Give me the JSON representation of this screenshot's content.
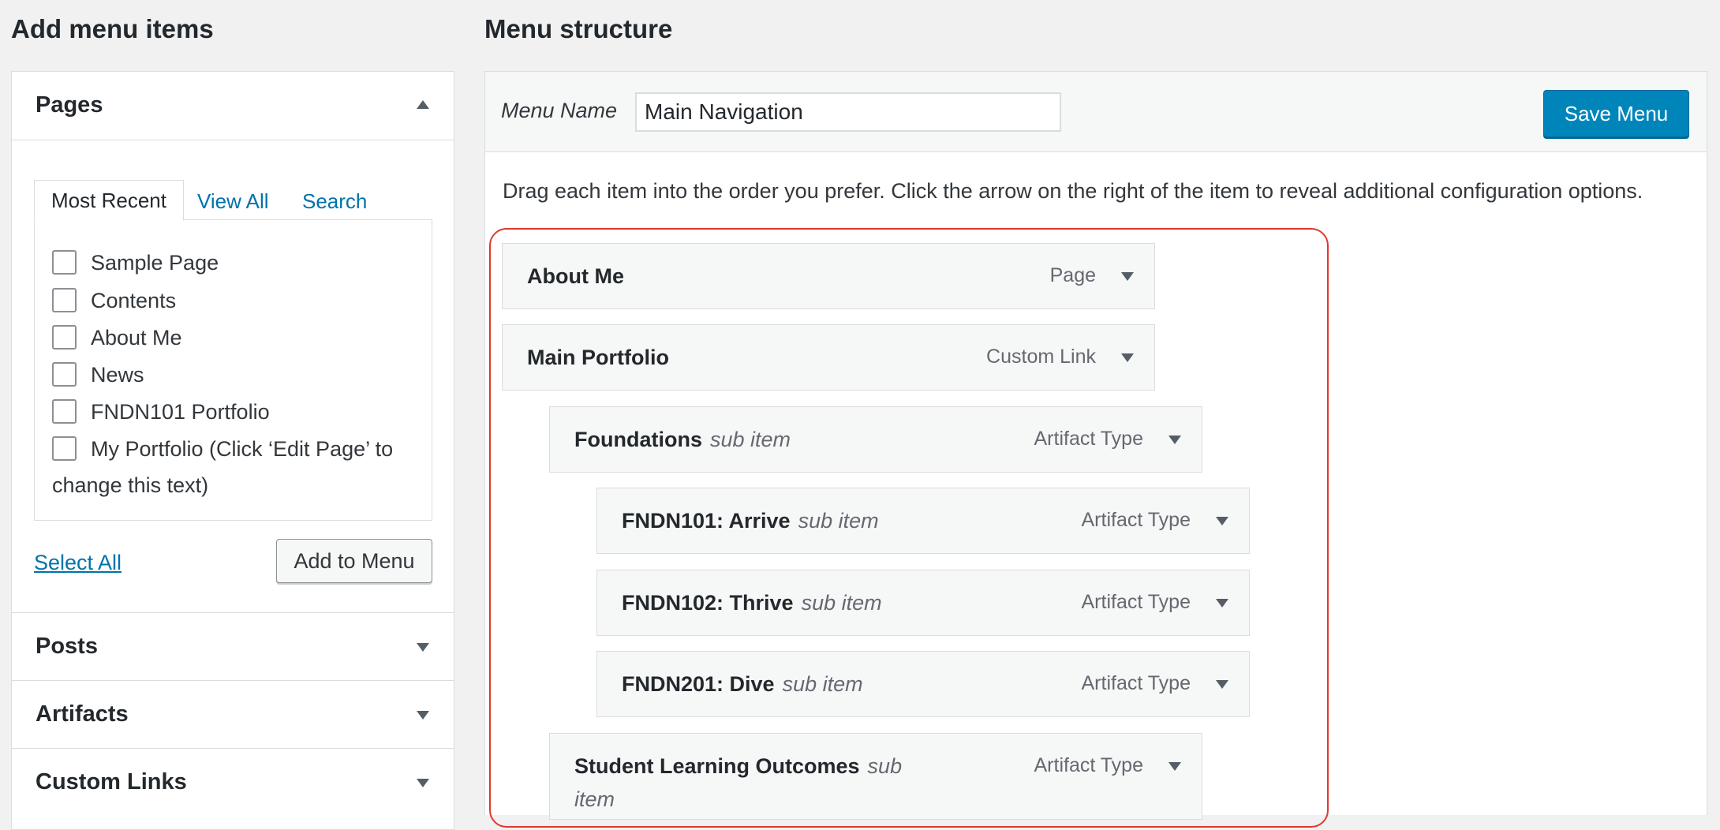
{
  "left": {
    "heading": "Add menu items",
    "pages": {
      "title": "Pages",
      "tabs": [
        "Most Recent",
        "View All",
        "Search"
      ],
      "items": [
        "Sample Page",
        "Contents",
        "About Me",
        "News",
        "FNDN101 Portfolio",
        "My Portfolio (Click ‘Edit Page’ to"
      ],
      "items_wrap": "change this text)",
      "select_all": "Select All",
      "add_button": "Add to Menu"
    },
    "sections": [
      "Posts",
      "Artifacts",
      "Custom Links"
    ]
  },
  "right": {
    "heading": "Menu structure",
    "menu_name_label": "Menu Name",
    "menu_name_value": "Main Navigation",
    "save_button": "Save Menu",
    "instructions": "Drag each item into the order you prefer. Click the arrow on the right of the item to reveal additional configuration options.",
    "sub_item_label": "sub item",
    "items": [
      {
        "title": "About Me",
        "type": "Page",
        "depth": 0
      },
      {
        "title": "Main Portfolio",
        "type": "Custom Link",
        "depth": 0
      },
      {
        "title": "Foundations",
        "type": "Artifact Type",
        "depth": 1
      },
      {
        "title": "FNDN101: Arrive",
        "type": "Artifact Type",
        "depth": 2
      },
      {
        "title": "FNDN102: Thrive",
        "type": "Artifact Type",
        "depth": 2
      },
      {
        "title": "FNDN201: Dive",
        "type": "Artifact Type",
        "depth": 2
      },
      {
        "title": "Student Learning Outcomes",
        "type": "Artifact Type",
        "depth": 1
      }
    ],
    "last_sub_line1": "sub",
    "last_sub_line2": "item"
  },
  "colors": {
    "primary_button": "#0085ba",
    "link": "#0073aa",
    "highlight_border": "#e0382e"
  }
}
